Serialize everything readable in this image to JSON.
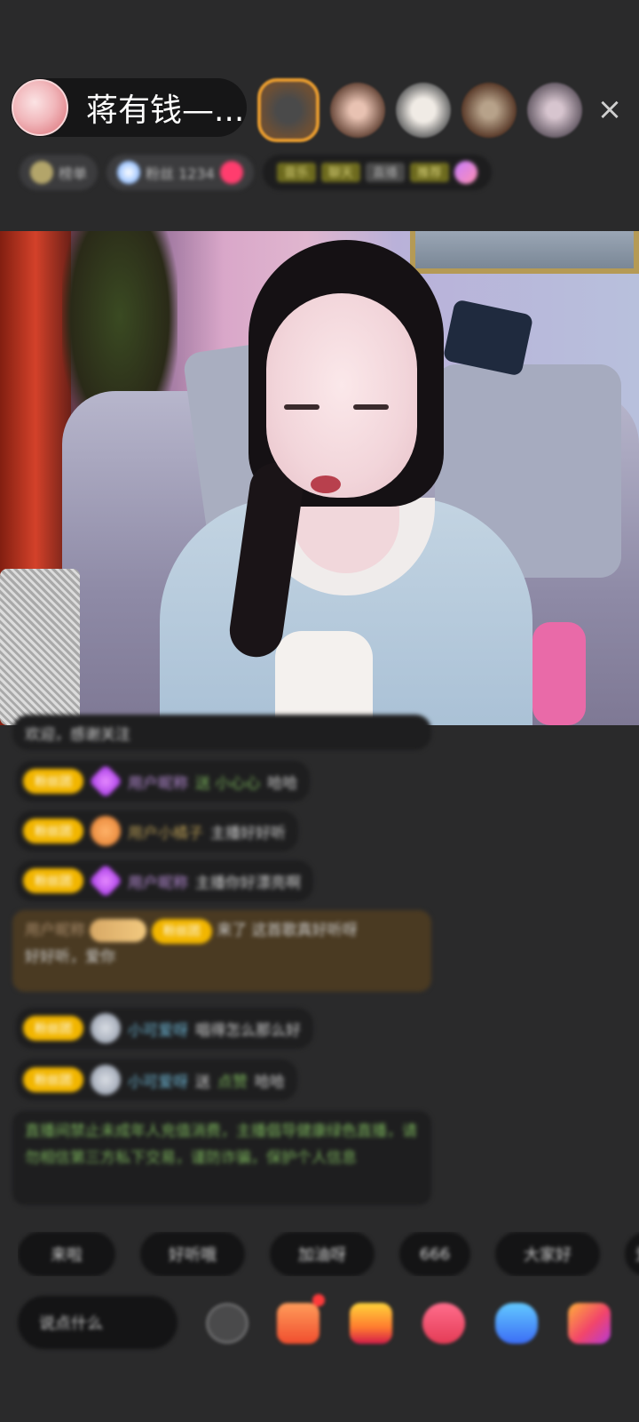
{
  "host": {
    "name": "蒋有钱—..."
  },
  "top": {
    "close_icon": "×",
    "viewer_icons": [
      "viewer-avatar-1",
      "viewer-avatar-2",
      "viewer-avatar-3",
      "viewer-avatar-4",
      "viewer-avatar-5"
    ]
  },
  "tags": {
    "t1": "榜单",
    "t2": "粉丝 1234",
    "chip1": "音乐",
    "chip2": "聊天",
    "chip3": "直播",
    "chip4": "推荐"
  },
  "chat": {
    "m0": "欢迎，感谢关注",
    "m1": {
      "badge": "粉丝团",
      "name": "用户昵称",
      "mid": "送 小心心",
      "text": "哈哈"
    },
    "m2": {
      "badge": "粉丝团",
      "name": "用户小橘子",
      "text": "主播好好听"
    },
    "m3": {
      "badge": "粉丝团",
      "name": "用户昵称",
      "text": "主播你好漂亮啊"
    },
    "m4": {
      "name": "用户昵称",
      "badge": "粉丝团",
      "text1": "来了",
      "text2": "这首歌真好听呀",
      "text3": "好好听，爱你"
    },
    "m5": {
      "badge": "粉丝团",
      "name": "小可爱呀",
      "text": "唱得怎么那么好"
    },
    "m6": {
      "badge": "粉丝团",
      "name": "小可爱呀",
      "mid": "送",
      "text": "点赞",
      "tail": "哈哈"
    },
    "system": "直播间禁止未成年人充值消费，主播倡导健康绿色直播，请勿相信第三方私下交易，谨防诈骗，保护个人信息"
  },
  "quick_replies": [
    "来啦",
    "好听哦",
    "加油呀",
    "666",
    "大家好",
    "爱了"
  ],
  "bottom": {
    "say_placeholder": "说点什么"
  },
  "colors": {
    "background": "#2a2a2b",
    "badge": "#f2b600",
    "accent_orange": "#e59a2f"
  }
}
